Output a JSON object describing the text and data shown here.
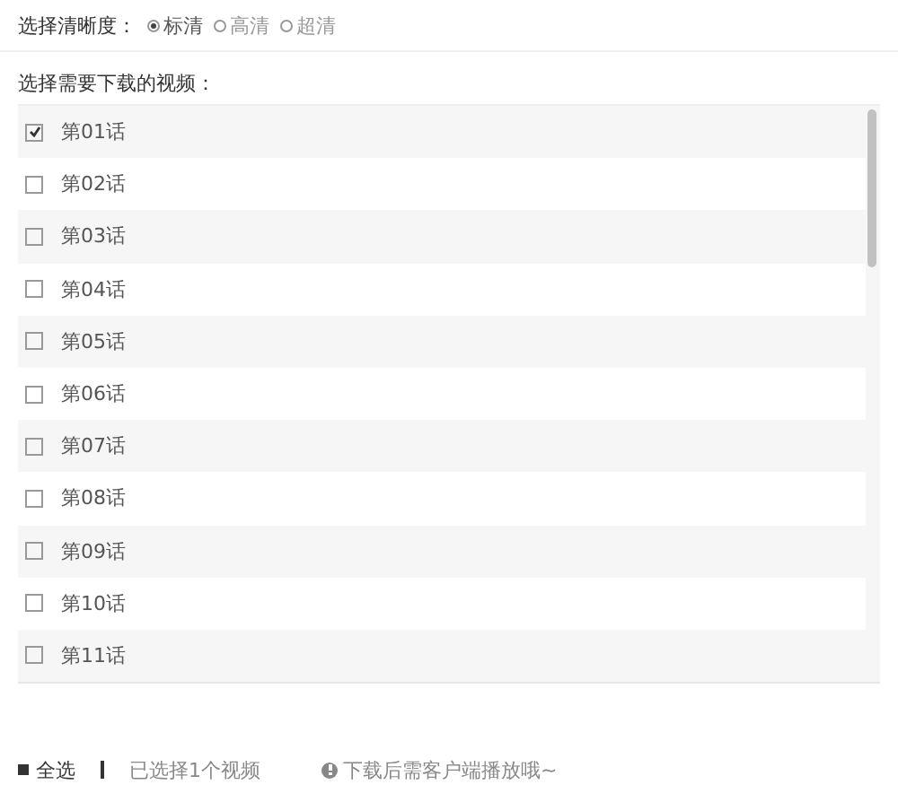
{
  "quality": {
    "label": "选择清晰度：",
    "options": [
      {
        "label": "标清",
        "selected": true
      },
      {
        "label": "高清",
        "selected": false
      },
      {
        "label": "超清",
        "selected": false
      }
    ]
  },
  "list_label": "选择需要下载的视频：",
  "episodes": [
    {
      "label": "第01话",
      "checked": true
    },
    {
      "label": "第02话",
      "checked": false
    },
    {
      "label": "第03话",
      "checked": false
    },
    {
      "label": "第04话",
      "checked": false
    },
    {
      "label": "第05话",
      "checked": false
    },
    {
      "label": "第06话",
      "checked": false
    },
    {
      "label": "第07话",
      "checked": false
    },
    {
      "label": "第08话",
      "checked": false
    },
    {
      "label": "第09话",
      "checked": false
    },
    {
      "label": "第10话",
      "checked": false
    },
    {
      "label": "第11话",
      "checked": false
    }
  ],
  "footer": {
    "select_all": "全选",
    "selected_count": "已选择1个视频",
    "notice": "下载后需客户端播放哦~"
  }
}
